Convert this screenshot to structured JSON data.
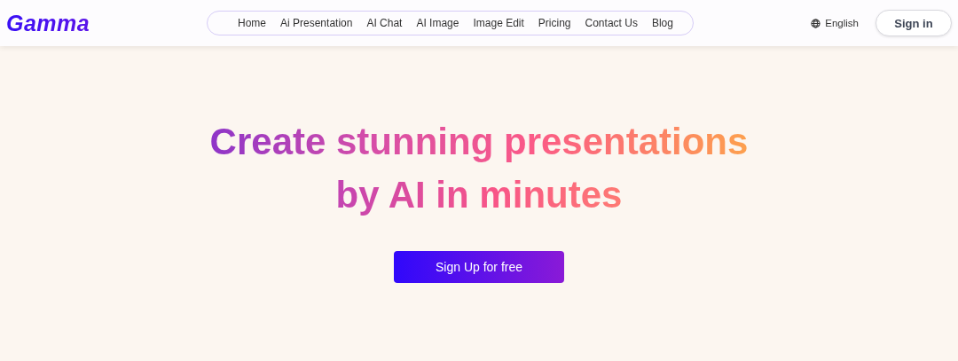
{
  "header": {
    "logo": "Gamma",
    "nav": [
      {
        "label": "Home"
      },
      {
        "label": "Ai Presentation"
      },
      {
        "label": "AI Chat"
      },
      {
        "label": "AI Image"
      },
      {
        "label": "Image Edit"
      },
      {
        "label": "Pricing"
      },
      {
        "label": "Contact Us"
      },
      {
        "label": "Blog"
      }
    ],
    "language": "English",
    "sign_in": "Sign in"
  },
  "hero": {
    "headline_lines": [
      "Create stunning presentations",
      "by AI in minutes"
    ],
    "cta": "Sign Up for free"
  }
}
